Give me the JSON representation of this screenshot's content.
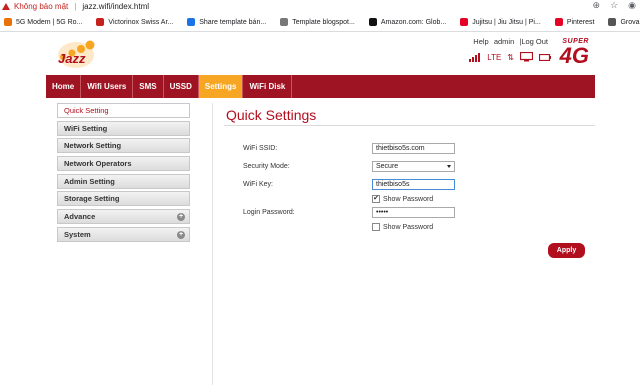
{
  "browser": {
    "security_warning": "Không bảo mật",
    "url": "jazz.wifi/index.html"
  },
  "bookmarks": [
    {
      "label": "5G Modem | 5G Ro...",
      "color": "#e8710a"
    },
    {
      "label": "Victorinox Swiss Ar...",
      "color": "#c5221f"
    },
    {
      "label": "Share template bán...",
      "color": "#1a73e8"
    },
    {
      "label": "Template blogspot...",
      "color": "#777777"
    },
    {
      "label": "Amazon.com: Glob...",
      "color": "#111111"
    },
    {
      "label": "Jujitsu | Jiu Jitsu | Pi...",
      "color": "#e60023"
    },
    {
      "label": "Pinterest",
      "color": "#e60023"
    },
    {
      "label": "Grovana Classic M...",
      "color": "#555555"
    }
  ],
  "header": {
    "logo_text": "Jazz",
    "links": {
      "help": "Help",
      "admin": "admin",
      "sep": "|",
      "logout": "Log Out"
    },
    "lte": "LTE",
    "brand_super": "SUPER",
    "brand_4g": "4G"
  },
  "nav": {
    "items": [
      {
        "label": "Home"
      },
      {
        "label": "Wifi Users"
      },
      {
        "label": "SMS"
      },
      {
        "label": "USSD"
      },
      {
        "label": "Settings"
      },
      {
        "label": "WiFi Disk"
      }
    ],
    "active_index": 4
  },
  "sidebar": {
    "items": [
      {
        "label": "Quick Setting"
      },
      {
        "label": "WiFi Setting"
      },
      {
        "label": "Network Setting"
      },
      {
        "label": "Network Operators"
      },
      {
        "label": "Admin Setting"
      },
      {
        "label": "Storage Setting"
      },
      {
        "label": "Advance",
        "expandable": true
      },
      {
        "label": "System",
        "expandable": true
      }
    ],
    "active_index": 0,
    "expand_glyph": "+"
  },
  "main": {
    "title": "Quick Settings",
    "form": {
      "ssid_label": "WiFi SSID:",
      "ssid_value": "thietbiso5s.com",
      "security_label": "Security Mode:",
      "security_value": "Secure",
      "key_label": "WiFi Key:",
      "key_value": "thietbiso5s",
      "show_password_1": "Show Password",
      "show_password_1_checked": true,
      "login_label": "Login Password:",
      "login_value": "•••••",
      "show_password_2": "Show Password",
      "show_password_2_checked": false,
      "apply_label": "Apply"
    }
  },
  "colors": {
    "brand_red": "#9e1422",
    "active_tab": "#f6a623"
  }
}
